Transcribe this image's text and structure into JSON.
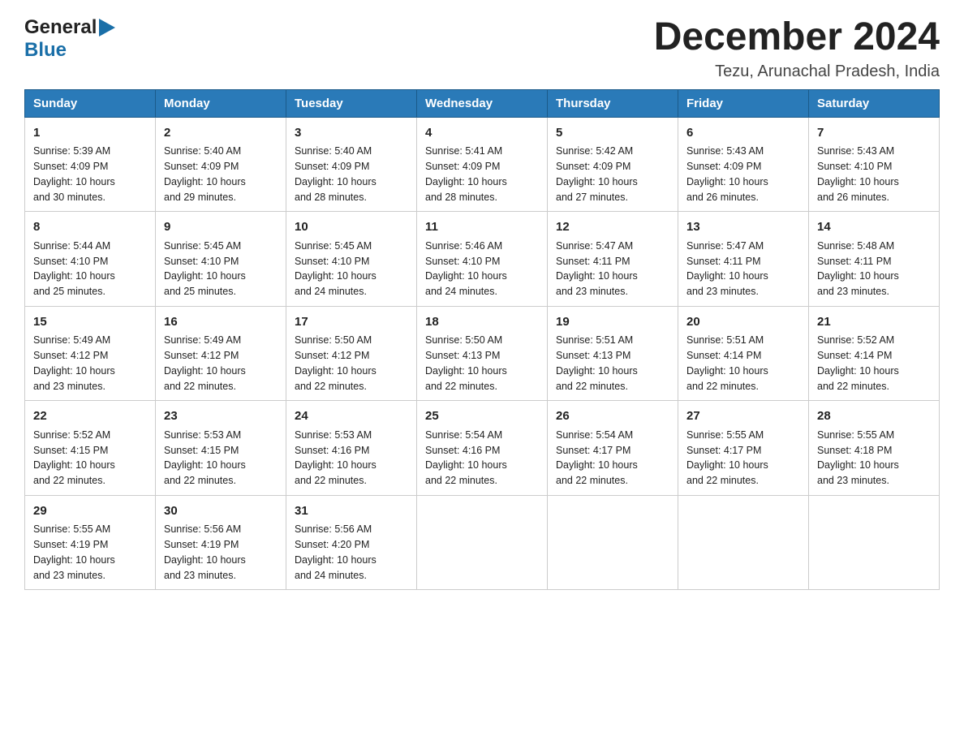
{
  "logo": {
    "general_text": "General",
    "blue_text": "Blue"
  },
  "header": {
    "month_year": "December 2024",
    "location": "Tezu, Arunachal Pradesh, India"
  },
  "weekdays": [
    "Sunday",
    "Monday",
    "Tuesday",
    "Wednesday",
    "Thursday",
    "Friday",
    "Saturday"
  ],
  "weeks": [
    [
      {
        "day": "1",
        "sunrise": "5:39 AM",
        "sunset": "4:09 PM",
        "daylight": "10 hours and 30 minutes."
      },
      {
        "day": "2",
        "sunrise": "5:40 AM",
        "sunset": "4:09 PM",
        "daylight": "10 hours and 29 minutes."
      },
      {
        "day": "3",
        "sunrise": "5:40 AM",
        "sunset": "4:09 PM",
        "daylight": "10 hours and 28 minutes."
      },
      {
        "day": "4",
        "sunrise": "5:41 AM",
        "sunset": "4:09 PM",
        "daylight": "10 hours and 28 minutes."
      },
      {
        "day": "5",
        "sunrise": "5:42 AM",
        "sunset": "4:09 PM",
        "daylight": "10 hours and 27 minutes."
      },
      {
        "day": "6",
        "sunrise": "5:43 AM",
        "sunset": "4:09 PM",
        "daylight": "10 hours and 26 minutes."
      },
      {
        "day": "7",
        "sunrise": "5:43 AM",
        "sunset": "4:10 PM",
        "daylight": "10 hours and 26 minutes."
      }
    ],
    [
      {
        "day": "8",
        "sunrise": "5:44 AM",
        "sunset": "4:10 PM",
        "daylight": "10 hours and 25 minutes."
      },
      {
        "day": "9",
        "sunrise": "5:45 AM",
        "sunset": "4:10 PM",
        "daylight": "10 hours and 25 minutes."
      },
      {
        "day": "10",
        "sunrise": "5:45 AM",
        "sunset": "4:10 PM",
        "daylight": "10 hours and 24 minutes."
      },
      {
        "day": "11",
        "sunrise": "5:46 AM",
        "sunset": "4:10 PM",
        "daylight": "10 hours and 24 minutes."
      },
      {
        "day": "12",
        "sunrise": "5:47 AM",
        "sunset": "4:11 PM",
        "daylight": "10 hours and 23 minutes."
      },
      {
        "day": "13",
        "sunrise": "5:47 AM",
        "sunset": "4:11 PM",
        "daylight": "10 hours and 23 minutes."
      },
      {
        "day": "14",
        "sunrise": "5:48 AM",
        "sunset": "4:11 PM",
        "daylight": "10 hours and 23 minutes."
      }
    ],
    [
      {
        "day": "15",
        "sunrise": "5:49 AM",
        "sunset": "4:12 PM",
        "daylight": "10 hours and 23 minutes."
      },
      {
        "day": "16",
        "sunrise": "5:49 AM",
        "sunset": "4:12 PM",
        "daylight": "10 hours and 22 minutes."
      },
      {
        "day": "17",
        "sunrise": "5:50 AM",
        "sunset": "4:12 PM",
        "daylight": "10 hours and 22 minutes."
      },
      {
        "day": "18",
        "sunrise": "5:50 AM",
        "sunset": "4:13 PM",
        "daylight": "10 hours and 22 minutes."
      },
      {
        "day": "19",
        "sunrise": "5:51 AM",
        "sunset": "4:13 PM",
        "daylight": "10 hours and 22 minutes."
      },
      {
        "day": "20",
        "sunrise": "5:51 AM",
        "sunset": "4:14 PM",
        "daylight": "10 hours and 22 minutes."
      },
      {
        "day": "21",
        "sunrise": "5:52 AM",
        "sunset": "4:14 PM",
        "daylight": "10 hours and 22 minutes."
      }
    ],
    [
      {
        "day": "22",
        "sunrise": "5:52 AM",
        "sunset": "4:15 PM",
        "daylight": "10 hours and 22 minutes."
      },
      {
        "day": "23",
        "sunrise": "5:53 AM",
        "sunset": "4:15 PM",
        "daylight": "10 hours and 22 minutes."
      },
      {
        "day": "24",
        "sunrise": "5:53 AM",
        "sunset": "4:16 PM",
        "daylight": "10 hours and 22 minutes."
      },
      {
        "day": "25",
        "sunrise": "5:54 AM",
        "sunset": "4:16 PM",
        "daylight": "10 hours and 22 minutes."
      },
      {
        "day": "26",
        "sunrise": "5:54 AM",
        "sunset": "4:17 PM",
        "daylight": "10 hours and 22 minutes."
      },
      {
        "day": "27",
        "sunrise": "5:55 AM",
        "sunset": "4:17 PM",
        "daylight": "10 hours and 22 minutes."
      },
      {
        "day": "28",
        "sunrise": "5:55 AM",
        "sunset": "4:18 PM",
        "daylight": "10 hours and 23 minutes."
      }
    ],
    [
      {
        "day": "29",
        "sunrise": "5:55 AM",
        "sunset": "4:19 PM",
        "daylight": "10 hours and 23 minutes."
      },
      {
        "day": "30",
        "sunrise": "5:56 AM",
        "sunset": "4:19 PM",
        "daylight": "10 hours and 23 minutes."
      },
      {
        "day": "31",
        "sunrise": "5:56 AM",
        "sunset": "4:20 PM",
        "daylight": "10 hours and 24 minutes."
      },
      null,
      null,
      null,
      null
    ]
  ],
  "labels": {
    "sunrise": "Sunrise:",
    "sunset": "Sunset:",
    "daylight": "Daylight:"
  }
}
